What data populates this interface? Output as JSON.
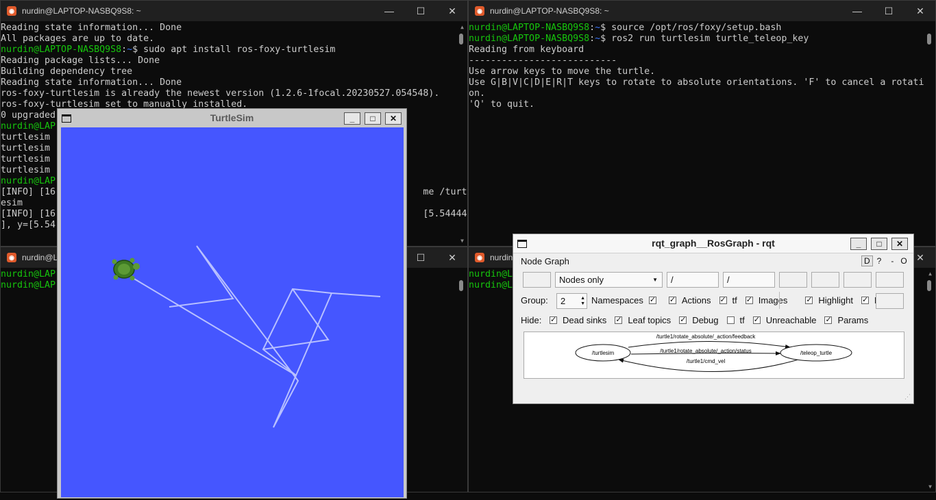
{
  "left_top_terminal": {
    "title": "nurdin@LAPTOP-NASBQ9S8: ~",
    "lines": [
      {
        "t": "Reading state information... Done"
      },
      {
        "t": "All packages are up to date."
      },
      {
        "prompt_user": "nurdin@LAPTOP-NASBQ9S8",
        "prompt_path": "~",
        "cmd": "$ sudo apt install ros-foxy-turtlesim"
      },
      {
        "t": "Reading package lists... Done"
      },
      {
        "t": "Building dependency tree"
      },
      {
        "t": "Reading state information... Done"
      },
      {
        "t": "ros-foxy-turtlesim is already the newest version (1.2.6-1focal.20230527.054548)."
      },
      {
        "t": "ros-foxy-turtlesim set to manually installed."
      },
      {
        "t": "0 upgraded"
      },
      {
        "t": "nurdin@LAP",
        "green": true
      },
      {
        "t": "turtlesim"
      },
      {
        "t": "turtlesim"
      },
      {
        "t": "turtlesim"
      },
      {
        "t": "turtlesim"
      },
      {
        "t": "nurdin@LAP",
        "green": true
      },
      {
        "t": "[INFO] [16                                                                   me /turtl"
      },
      {
        "t": "esim"
      },
      {
        "t": "[INFO] [16                                                                   [5.544445"
      },
      {
        "t": "], y=[5.54"
      }
    ]
  },
  "left_bottom_terminal": {
    "title": "nurdin@LAP",
    "lines": [
      {
        "t": "nurdin@LAP",
        "green": true
      },
      {
        "t": "nurdin@LAP",
        "green": true
      }
    ]
  },
  "right_top_terminal": {
    "title": "nurdin@LAPTOP-NASBQ9S8: ~",
    "lines": [
      {
        "prompt_user": "nurdin@LAPTOP-NASBQ9S8",
        "prompt_path": "~",
        "cmd": "$ source /opt/ros/foxy/setup.bash"
      },
      {
        "prompt_user": "nurdin@LAPTOP-NASBQ9S8",
        "prompt_path": "~",
        "cmd": "$ ros2 run turtlesim turtle_teleop_key"
      },
      {
        "t": "Reading from keyboard"
      },
      {
        "t": "---------------------------"
      },
      {
        "t": "Use arrow keys to move the turtle."
      },
      {
        "t": "Use G|B|V|C|D|E|R|T keys to rotate to absolute orientations. 'F' to cancel a rotati"
      },
      {
        "t": "on."
      },
      {
        "t": "'Q' to quit."
      }
    ]
  },
  "right_bottom_terminal": {
    "title": "nurdin@LAP",
    "lines": [
      {
        "t": "nurdin@LAP",
        "green": true
      },
      {
        "t": "nurdin@LAP",
        "green": true
      }
    ]
  },
  "window_controls": {
    "minimize": "—",
    "maximize": "☐",
    "close": "✕"
  },
  "turtlesim": {
    "title": "TurtleSim",
    "controls": {
      "minimize": "_",
      "maximize": "□",
      "close": "✕"
    },
    "background_color": "#4556ff",
    "trail_color": "#b8c0ff"
  },
  "rqt": {
    "title": "rqt_graph__RosGraph - rqt",
    "controls": {
      "minimize": "_",
      "maximize": "□",
      "close": "✕"
    },
    "plugin_title": "Node Graph",
    "plugin_buttons": {
      "d": "D",
      "help": "?",
      "minus": "-",
      "o": "O"
    },
    "filter_select": "Nodes only",
    "ns_filter": "/",
    "topic_filter": "/",
    "group_label": "Group:",
    "group_value": "2",
    "options": [
      {
        "label": "Namespaces",
        "checked": true
      },
      {
        "label": "Actions",
        "checked": true
      },
      {
        "label": "tf",
        "checked": true
      },
      {
        "label": "Images",
        "checked": true
      },
      {
        "label": "Highlight",
        "checked": true
      },
      {
        "label": "Fit",
        "checked": true
      }
    ],
    "hide_label": "Hide:",
    "hide_options": [
      {
        "label": "Dead sinks",
        "checked": true
      },
      {
        "label": "Leaf topics",
        "checked": true
      },
      {
        "label": "Debug",
        "checked": true
      },
      {
        "label": "tf",
        "checked": false
      },
      {
        "label": "Unreachable",
        "checked": true
      },
      {
        "label": "Params",
        "checked": true
      }
    ],
    "graph": {
      "nodes": [
        "/turtlesim",
        "/teleop_turtle"
      ],
      "edges": [
        "/turtle1/rotate_absolute/_action/feedback",
        "/turtle1/rotate_absolute/_action/status",
        "/turtle1/cmd_vel"
      ]
    }
  }
}
